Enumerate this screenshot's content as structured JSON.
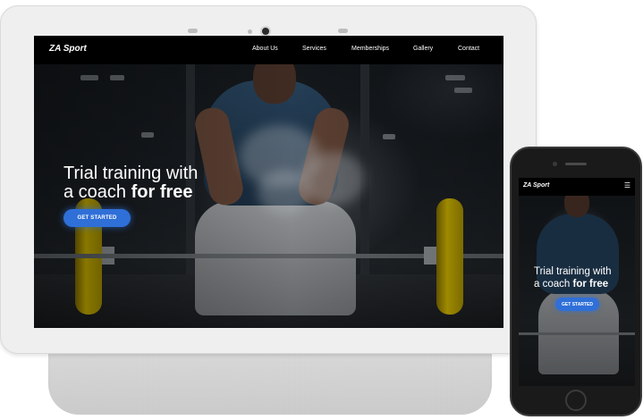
{
  "site": {
    "brand": "ZA Sport",
    "nav": [
      "About Us",
      "Services",
      "Memberships",
      "Gallery",
      "Contact"
    ]
  },
  "hero": {
    "title_line1": "Trial training with",
    "title_line2_prefix": "a coach ",
    "title_line2_bold": "for free",
    "cta_label": "GET STARTED"
  },
  "mobile": {
    "brand": "ZA Sport",
    "menu_icon": "☰",
    "title_line1": "Trial training with",
    "title_line2_prefix": "a coach ",
    "title_line2_bold": "for free",
    "cta_label": "GET STARTED"
  },
  "colors": {
    "accent": "#2f6fd8",
    "navbar": "#000000",
    "plate": "#e0c400"
  }
}
